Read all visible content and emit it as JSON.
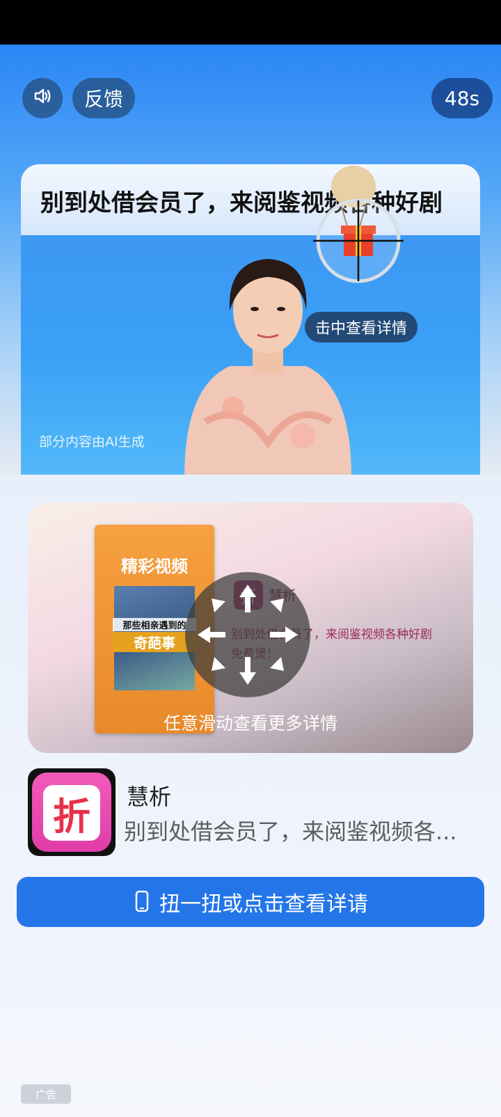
{
  "header": {
    "feedback_label": "反馈",
    "countdown": "48s",
    "sound_icon": "speaker-icon"
  },
  "video": {
    "banner_text": "别到处借会员了，来阅鉴视频各种好剧",
    "hit_label": "击中查看详情",
    "ai_note": "部分内容由AI生成"
  },
  "ad_card": {
    "poster_title": "精彩视频",
    "poster_caption1": "那些相亲遇到的",
    "poster_caption2": "奇葩事",
    "app_icon_char": "折",
    "app_name": "慧析",
    "description": "别到处借会员了，来阅鉴视频各种好剧免费煲！",
    "swipe_hint": "任意滑动查看更多详情"
  },
  "app": {
    "icon_char": "折",
    "name": "慧析",
    "description": "别到处借会员了，来阅鉴视频各..."
  },
  "cta": {
    "label": "扭一扭或点击查看详请",
    "icon": "phone-icon"
  },
  "ad_badge": "广告",
  "colors": {
    "accent": "#2476e8",
    "status_bar": "#000000"
  }
}
